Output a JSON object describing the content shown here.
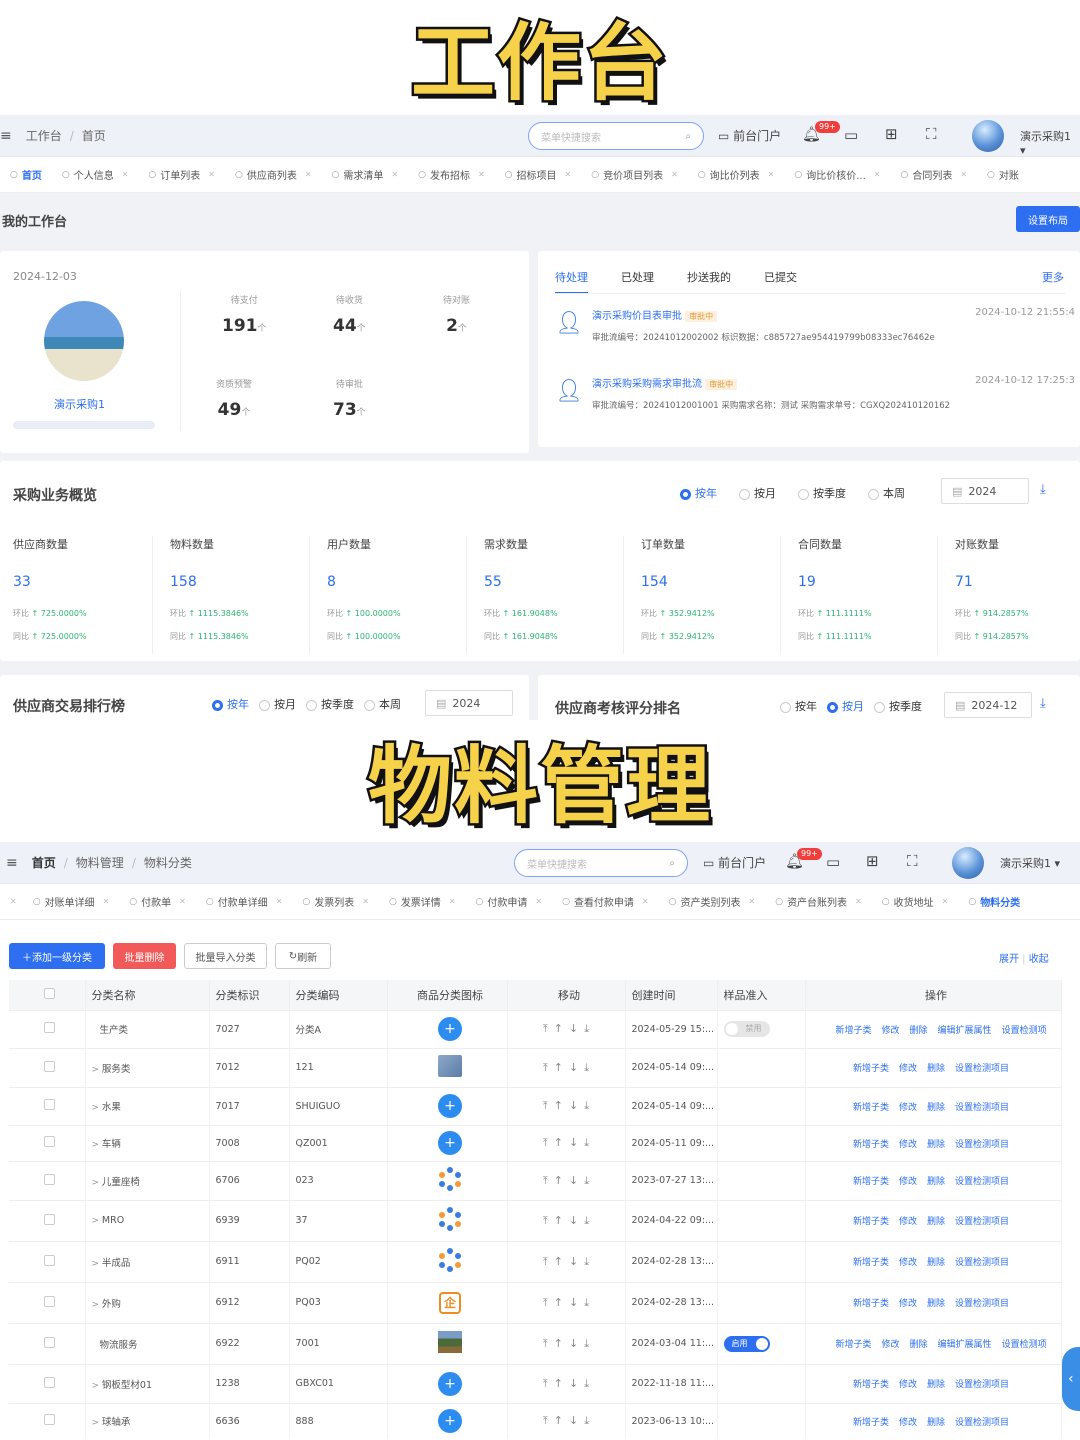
{
  "banner1": "工作台",
  "banner2": "物料管理",
  "s1": {
    "crumb": [
      "工作台",
      "首页"
    ],
    "search_placeholder": "菜单快捷搜索",
    "portal": "前台门户",
    "badge": "99+",
    "user": "演示采购1",
    "tabs": [
      "首页",
      "个人信息",
      "订单列表",
      "供应商列表",
      "需求清单",
      "发布招标",
      "招标项目",
      "竞价项目列表",
      "询比价列表",
      "询比价核价...",
      "合同列表",
      "对账"
    ],
    "title": "我的工作台",
    "layout_btn": "设置布局",
    "date": "2024-12-03",
    "username": "演示采购1",
    "stats": [
      {
        "label": "待支付",
        "value": "191",
        "unit": "个"
      },
      {
        "label": "待收货",
        "value": "44",
        "unit": "个"
      },
      {
        "label": "待对账",
        "value": "2",
        "unit": "个"
      },
      {
        "label": "资质预警",
        "value": "49",
        "unit": "个"
      },
      {
        "label": "待审批",
        "value": "73",
        "unit": "个"
      }
    ],
    "todo_tabs": [
      "待处理",
      "已处理",
      "抄送我的",
      "已提交"
    ],
    "more": "更多",
    "todos": [
      {
        "title": "演示采购价目表审批",
        "status": "审批中",
        "time": "2024-10-12 21:55:4",
        "desc": "审批流编号：20241012002002  标识数据：c885727ae954419799b08333ec76462e"
      },
      {
        "title": "演示采购采购需求审批流",
        "status": "审批中",
        "time": "2024-10-12 17:25:3",
        "desc": "审批流编号：20241012001001  采购需求名称：测试  采购需求单号：CGXQ202410120162"
      }
    ],
    "overview_title": "采购业务概览",
    "period_opts": [
      "按年",
      "按月",
      "按季度",
      "本周"
    ],
    "year": "2024",
    "metrics": [
      {
        "label": "供应商数量",
        "value": "33",
        "mom": "725.0000%",
        "yoy": "725.0000%"
      },
      {
        "label": "物料数量",
        "value": "158",
        "mom": "1115.3846%",
        "yoy": "1115.3846%"
      },
      {
        "label": "用户数量",
        "value": "8",
        "mom": "100.0000%",
        "yoy": "100.0000%"
      },
      {
        "label": "需求数量",
        "value": "55",
        "mom": "161.9048%",
        "yoy": "161.9048%"
      },
      {
        "label": "订单数量",
        "value": "154",
        "mom": "352.9412%",
        "yoy": "352.9412%"
      },
      {
        "label": "合同数量",
        "value": "19",
        "mom": "111.1111%",
        "yoy": "111.1111%"
      },
      {
        "label": "对账数量",
        "value": "71",
        "mom": "914.2857%",
        "yoy": "914.2857%"
      }
    ],
    "mom_label": "环比",
    "yoy_label": "同比",
    "rank_title": "供应商交易排行榜",
    "score_title": "供应商考核评分排名",
    "month": "2024-12"
  },
  "s2": {
    "crumb": [
      "首页",
      "物料管理",
      "物料分类"
    ],
    "search_placeholder": "菜单快捷搜索",
    "portal": "前台门户",
    "badge": "99+",
    "user": "演示采购1",
    "tabs": [
      "对账单详细",
      "付款单",
      "付款单详细",
      "发票列表",
      "发票详情",
      "付款申请",
      "查看付款申请",
      "资产类别列表",
      "资产台账列表",
      "收货地址",
      "物料分类"
    ],
    "btn_add": "添加一级分类",
    "btn_del": "批量删除",
    "btn_import": "批量导入分类",
    "btn_refresh": "刷新",
    "expand": "展开",
    "collapse": "收起",
    "columns": [
      "分类名称",
      "分类标识",
      "分类编码",
      "商品分类图标",
      "移动",
      "创建时间",
      "样品准入",
      "操作"
    ],
    "rows": [
      {
        "name": "生产类",
        "id": "7027",
        "code": "分类A",
        "icon": "plus",
        "time": "2024-05-29 15:...",
        "toggle": "禁用",
        "ops": [
          "新增子类",
          "修改",
          "删除",
          "编辑扩展属性",
          "设置检测项"
        ]
      },
      {
        "name": "服务类",
        "id": "7012",
        "code": "121",
        "icon": "img",
        "time": "2024-05-14 09:...",
        "toggle": "",
        "ops": [
          "新增子类",
          "修改",
          "删除",
          "设置检测项目"
        ]
      },
      {
        "name": "水果",
        "id": "7017",
        "code": "SHUIGUO",
        "icon": "plus",
        "time": "2024-05-14 09:...",
        "toggle": "",
        "ops": [
          "新增子类",
          "修改",
          "删除",
          "设置检测项目"
        ]
      },
      {
        "name": "车辆",
        "id": "7008",
        "code": "QZ001",
        "icon": "plus",
        "time": "2024-05-11 09:...",
        "toggle": "",
        "ops": [
          "新增子类",
          "修改",
          "删除",
          "设置检测项目"
        ]
      },
      {
        "name": "儿童座椅",
        "id": "6706",
        "code": "023",
        "icon": "dots",
        "time": "2023-07-27 13:...",
        "toggle": "",
        "ops": [
          "新增子类",
          "修改",
          "删除",
          "设置检测项目"
        ]
      },
      {
        "name": "MRO",
        "id": "6939",
        "code": "37",
        "icon": "dots",
        "time": "2024-04-22 09:...",
        "toggle": "",
        "ops": [
          "新增子类",
          "修改",
          "删除",
          "设置检测项目"
        ]
      },
      {
        "name": "半成品",
        "id": "6911",
        "code": "PQ02",
        "icon": "dots",
        "time": "2024-02-28 13:...",
        "toggle": "",
        "ops": [
          "新增子类",
          "修改",
          "删除",
          "设置检测项目"
        ]
      },
      {
        "name": "外购",
        "id": "6912",
        "code": "PQ03",
        "icon": "qi",
        "time": "2024-02-28 13:...",
        "toggle": "",
        "ops": [
          "新增子类",
          "修改",
          "删除",
          "设置检测项目"
        ]
      },
      {
        "name": "物流服务",
        "id": "6922",
        "code": "7001",
        "icon": "photo",
        "time": "2024-03-04 11:...",
        "toggle": "启用",
        "ops": [
          "新增子类",
          "修改",
          "删除",
          "编辑扩展属性",
          "设置检测项"
        ]
      },
      {
        "name": "钢板型材01",
        "id": "1238",
        "code": "GBXC01",
        "icon": "plus",
        "time": "2022-11-18 11:...",
        "toggle": "",
        "ops": [
          "新增子类",
          "修改",
          "删除",
          "设置检测项目"
        ]
      },
      {
        "name": "球轴承",
        "id": "6636",
        "code": "888",
        "icon": "plus",
        "time": "2023-06-13 10:...",
        "toggle": "",
        "ops": [
          "新增子类",
          "修改",
          "删除",
          "设置检测项目"
        ]
      }
    ]
  }
}
